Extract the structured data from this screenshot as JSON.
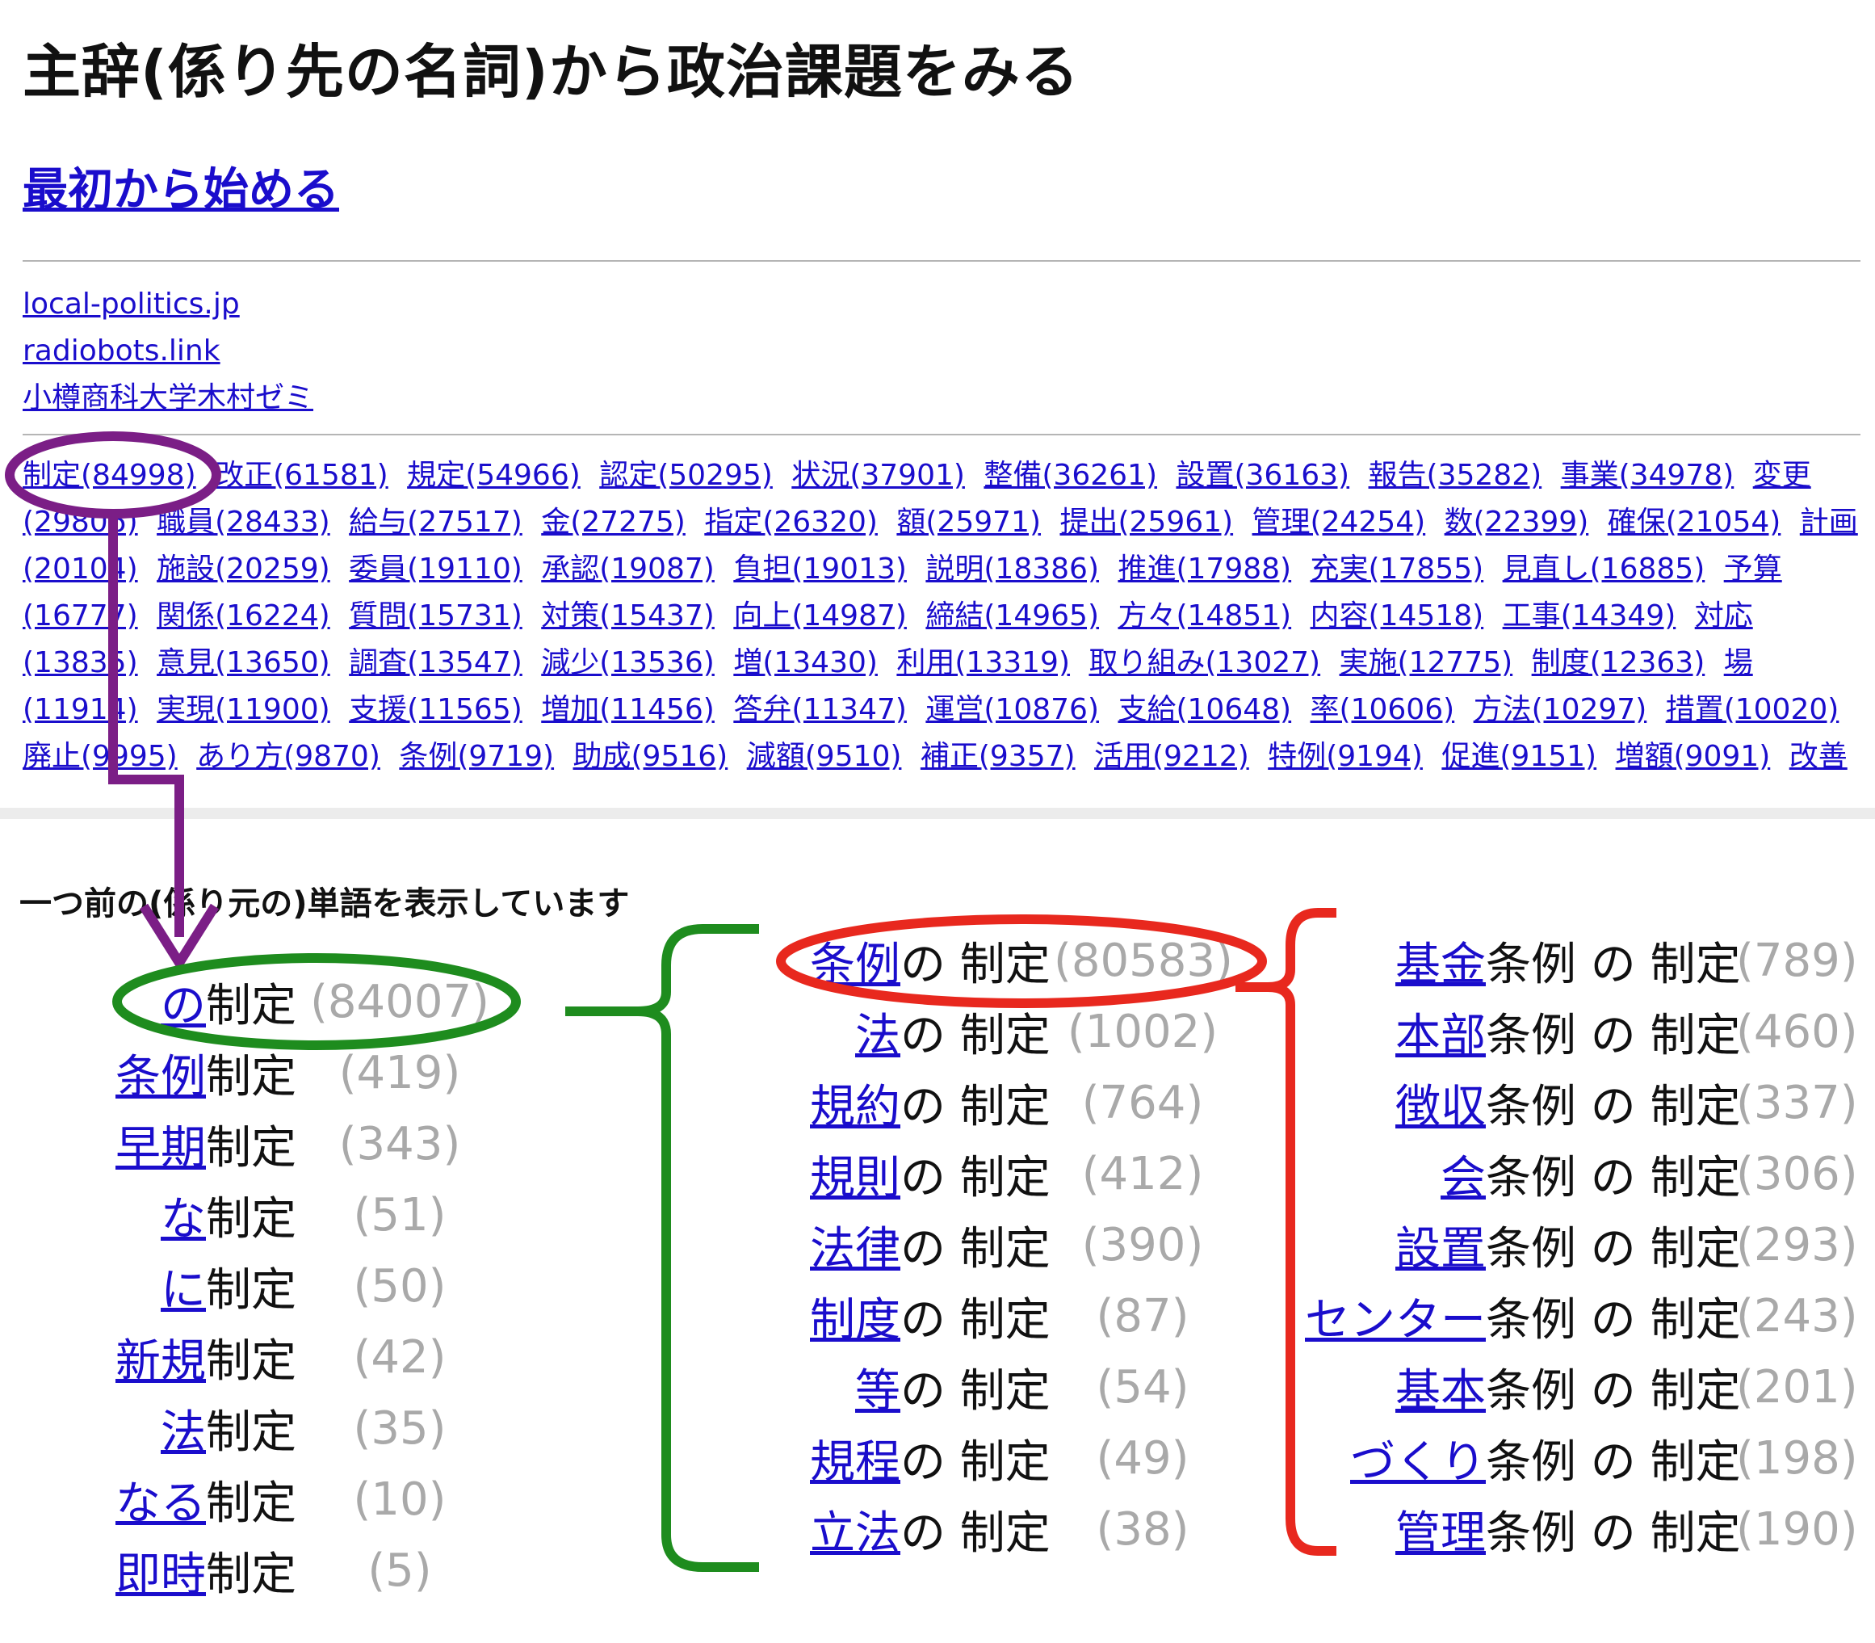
{
  "title": "主辞(係り先の名詞)から政治課題をみる",
  "restart_link": "最初から始める",
  "external_links": [
    "local-politics.jp",
    "radiobots.link",
    "小樽商科大学木村ゼミ"
  ],
  "word_links": [
    "制定(84998)",
    "改正(61581)",
    "規定(54966)",
    "認定(50295)",
    "状況(37901)",
    "整備(36261)",
    "設置(36163)",
    "報告(35282)",
    "事業(34978)",
    "変更(29806)",
    "職員(28433)",
    "給与(27517)",
    "金(27275)",
    "指定(26320)",
    "額(25971)",
    "提出(25961)",
    "管理(24254)",
    "数(22399)",
    "確保(21054)",
    "計画(20104)",
    "施設(20259)",
    "委員(19110)",
    "承認(19087)",
    "負担(19013)",
    "説明(18386)",
    "推進(17988)",
    "充実(17855)",
    "見直し(16885)",
    "予算(16777)",
    "関係(16224)",
    "質問(15731)",
    "対策(15437)",
    "向上(14987)",
    "締結(14965)",
    "方々(14851)",
    "内容(14518)",
    "工事(14349)",
    "対応(13835)",
    "意見(13650)",
    "調査(13547)",
    "減少(13536)",
    "増(13430)",
    "利用(13319)",
    "取り組み(13027)",
    "実施(12775)",
    "制度(12363)",
    "場(11914)",
    "実現(11900)",
    "支援(11565)",
    "増加(11456)",
    "答弁(11347)",
    "運営(10876)",
    "支給(10648)",
    "率(10606)",
    "方法(10297)",
    "措置(10020)",
    "廃止(9995)",
    "あり方(9870)",
    "条例(9719)",
    "助成(9516)",
    "減額(9510)",
    "補正(9357)",
    "活用(9212)",
    "特例(9194)",
    "促進(9151)",
    "増額(9091)",
    "改善"
  ],
  "notice": "一つ前の(係り元の)単語を表示しています",
  "col1": [
    {
      "word": "の",
      "tail": "制定",
      "count": "(84007)"
    },
    {
      "word": "条例",
      "tail": "制定",
      "count": "(419)"
    },
    {
      "word": "早期",
      "tail": "制定",
      "count": "(343)"
    },
    {
      "word": "な",
      "tail": "制定",
      "count": "(51)"
    },
    {
      "word": "に",
      "tail": "制定",
      "count": "(50)"
    },
    {
      "word": "新規",
      "tail": "制定",
      "count": "(42)"
    },
    {
      "word": "法",
      "tail": "制定",
      "count": "(35)"
    },
    {
      "word": "なる",
      "tail": "制定",
      "count": "(10)"
    },
    {
      "word": "即時",
      "tail": "制定",
      "count": "(5)"
    }
  ],
  "col2": [
    {
      "word": "条例",
      "tail": "の 制定",
      "count": "(80583)"
    },
    {
      "word": "法",
      "tail": "の 制定",
      "count": "(1002)"
    },
    {
      "word": "規約",
      "tail": "の 制定",
      "count": "(764)"
    },
    {
      "word": "規則",
      "tail": "の 制定",
      "count": "(412)"
    },
    {
      "word": "法律",
      "tail": "の 制定",
      "count": "(390)"
    },
    {
      "word": "制度",
      "tail": "の 制定",
      "count": "(87)"
    },
    {
      "word": "等",
      "tail": "の 制定",
      "count": "(54)"
    },
    {
      "word": "規程",
      "tail": "の 制定",
      "count": "(49)"
    },
    {
      "word": "立法",
      "tail": "の 制定",
      "count": "(38)"
    }
  ],
  "col3": [
    {
      "word": "基金",
      "tail": "条例 の 制定",
      "count": "(789)"
    },
    {
      "word": "本部",
      "tail": "条例 の 制定",
      "count": "(460)"
    },
    {
      "word": "徴収",
      "tail": "条例 の 制定",
      "count": "(337)"
    },
    {
      "word": "会",
      "tail": "条例 の 制定",
      "count": "(306)"
    },
    {
      "word": "設置",
      "tail": "条例 の 制定",
      "count": "(293)"
    },
    {
      "word": "センター",
      "tail": "条例 の 制定",
      "count": "(243)"
    },
    {
      "word": "基本",
      "tail": "条例 の 制定",
      "count": "(201)"
    },
    {
      "word": "づくり",
      "tail": "条例 の 制定",
      "count": "(198)"
    },
    {
      "word": "管理",
      "tail": "条例 の 制定",
      "count": "(190)"
    }
  ],
  "colors": {
    "link": "#1a0dcc",
    "count": "#a9a9a9",
    "purple_annotation": "#7b1e86",
    "green_annotation": "#1e8c1e",
    "red_annotation": "#e8281e"
  }
}
